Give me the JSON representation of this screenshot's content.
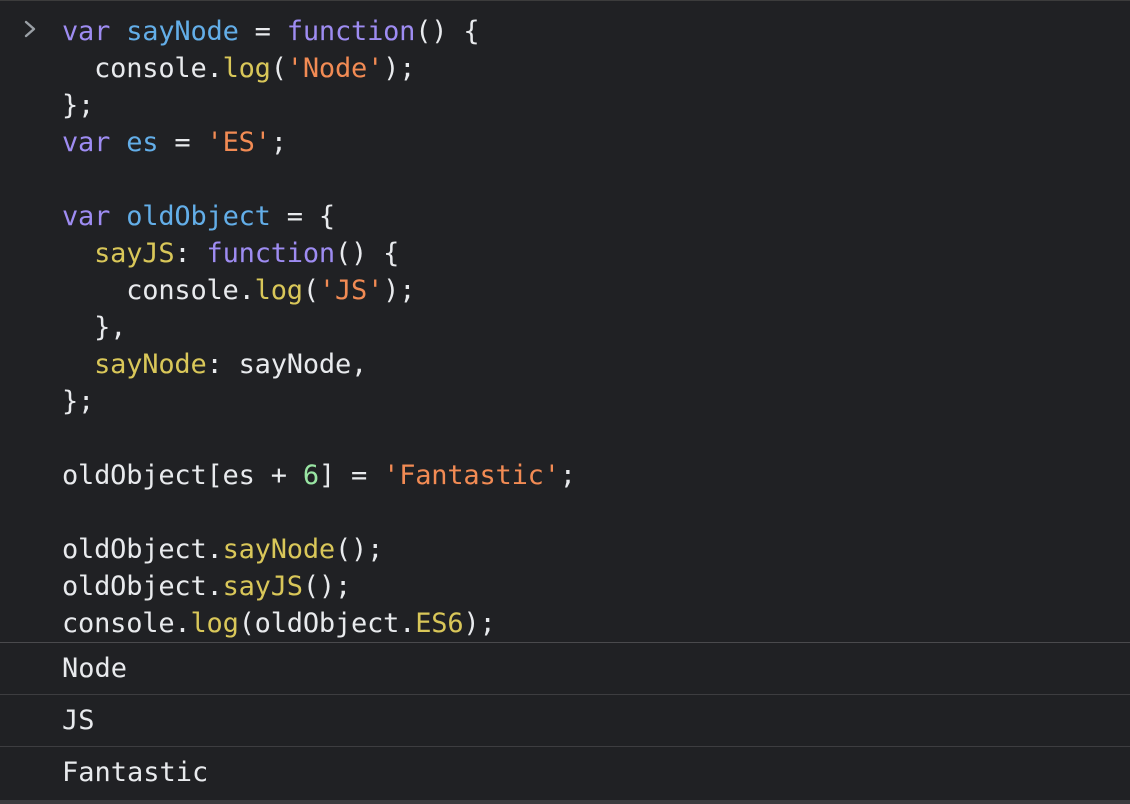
{
  "colors": {
    "keyword": "#9e8cf2",
    "identifier": "#63aee8",
    "string": "#f28b54",
    "method": "#d9c759",
    "number": "#99e5a3",
    "text": "#e8eaed",
    "background": "#202124"
  },
  "prompt_icon": "chevron-right-icon",
  "code_lines": [
    [
      {
        "t": "var",
        "c": "keyword"
      },
      {
        "t": " "
      },
      {
        "t": "sayNode",
        "c": "identifier"
      },
      {
        "t": " = "
      },
      {
        "t": "function",
        "c": "keyword"
      },
      {
        "t": "() {"
      }
    ],
    [
      {
        "t": "  console."
      },
      {
        "t": "log",
        "c": "method"
      },
      {
        "t": "("
      },
      {
        "t": "'Node'",
        "c": "string"
      },
      {
        "t": ");"
      }
    ],
    [
      {
        "t": "};"
      }
    ],
    [
      {
        "t": "var",
        "c": "keyword"
      },
      {
        "t": " "
      },
      {
        "t": "es",
        "c": "identifier"
      },
      {
        "t": " = "
      },
      {
        "t": "'ES'",
        "c": "string"
      },
      {
        "t": ";"
      }
    ],
    [],
    [
      {
        "t": "var",
        "c": "keyword"
      },
      {
        "t": " "
      },
      {
        "t": "oldObject",
        "c": "identifier"
      },
      {
        "t": " = {"
      }
    ],
    [
      {
        "t": "  "
      },
      {
        "t": "sayJS",
        "c": "method"
      },
      {
        "t": ": "
      },
      {
        "t": "function",
        "c": "keyword"
      },
      {
        "t": "() {"
      }
    ],
    [
      {
        "t": "    console."
      },
      {
        "t": "log",
        "c": "method"
      },
      {
        "t": "("
      },
      {
        "t": "'JS'",
        "c": "string"
      },
      {
        "t": ");"
      }
    ],
    [
      {
        "t": "  },"
      }
    ],
    [
      {
        "t": "  "
      },
      {
        "t": "sayNode",
        "c": "method"
      },
      {
        "t": ": sayNode,"
      }
    ],
    [
      {
        "t": "};"
      }
    ],
    [],
    [
      {
        "t": "oldObject[es + "
      },
      {
        "t": "6",
        "c": "number"
      },
      {
        "t": "] = "
      },
      {
        "t": "'Fantastic'",
        "c": "string"
      },
      {
        "t": ";"
      }
    ],
    [],
    [
      {
        "t": "oldObject."
      },
      {
        "t": "sayNode",
        "c": "method"
      },
      {
        "t": "();"
      }
    ],
    [
      {
        "t": "oldObject."
      },
      {
        "t": "sayJS",
        "c": "method"
      },
      {
        "t": "();"
      }
    ],
    [
      {
        "t": "console."
      },
      {
        "t": "log",
        "c": "method"
      },
      {
        "t": "(oldObject."
      },
      {
        "t": "ES6",
        "c": "method"
      },
      {
        "t": ");"
      }
    ]
  ],
  "outputs": [
    "Node",
    "JS",
    "Fantastic"
  ]
}
